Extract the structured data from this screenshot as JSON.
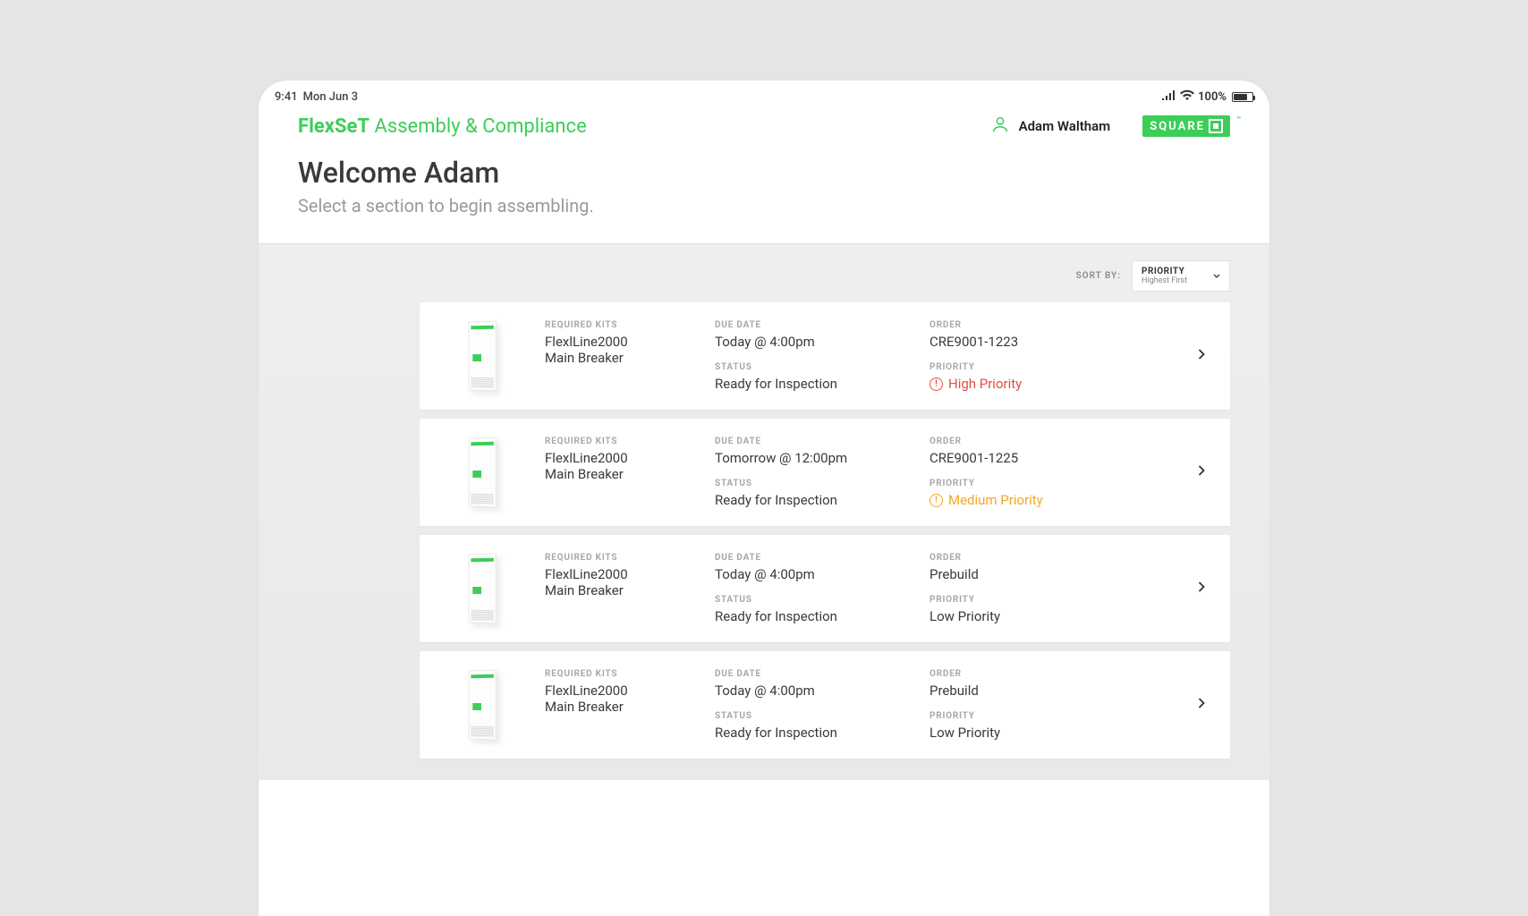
{
  "statusbar": {
    "time": "9:41",
    "date": "Mon Jun 3",
    "battery": "100%"
  },
  "header": {
    "brand_bold": "FlexSeT",
    "brand_rest": " Assembly & Compliance",
    "user_name": "Adam Waltham",
    "logo_text": "SQUARE"
  },
  "welcome": {
    "title": "Welcome Adam",
    "subtitle": "Select a section to begin assembling."
  },
  "sort": {
    "label": "SORT BY:",
    "option": "PRIORITY",
    "sub": "Highest First"
  },
  "labels": {
    "required_kits": "REQUIRED KITS",
    "due_date": "DUE DATE",
    "status": "STATUS",
    "order": "ORDER",
    "priority": "PRIORITY"
  },
  "items": [
    {
      "kit1": "FlexlLine2000",
      "kit2": "Main Breaker",
      "due": "Today @ 4:00pm",
      "status": "Ready for Inspection",
      "order": "CRE9001-1223",
      "priority": "High Priority",
      "priority_level": "high"
    },
    {
      "kit1": "FlexlLine2000",
      "kit2": "Main Breaker",
      "due": "Tomorrow @ 12:00pm",
      "status": "Ready for Inspection",
      "order": "CRE9001-1225",
      "priority": "Medium Priority",
      "priority_level": "med"
    },
    {
      "kit1": "FlexlLine2000",
      "kit2": "Main Breaker",
      "due": "Today @ 4:00pm",
      "status": "Ready for Inspection",
      "order": "Prebuild",
      "priority": "Low Priority",
      "priority_level": "low"
    },
    {
      "kit1": "FlexlLine2000",
      "kit2": "Main Breaker",
      "due": "Today @ 4:00pm",
      "status": "Ready for Inspection",
      "order": "Prebuild",
      "priority": "Low Priority",
      "priority_level": "low"
    }
  ]
}
